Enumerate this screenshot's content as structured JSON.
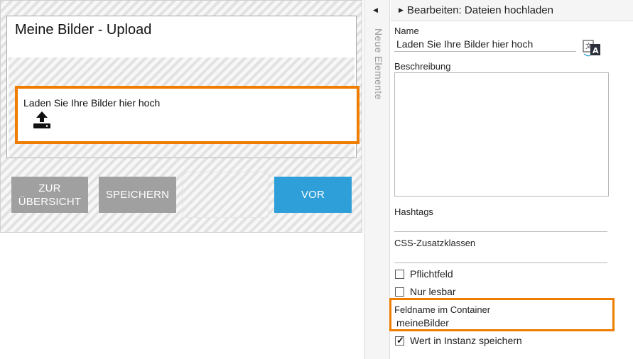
{
  "form": {
    "title": "Meine Bilder - Upload",
    "upload_label": "Laden Sie Ihre Bilder hier hoch",
    "upload_icon": "upload-icon",
    "buttons": {
      "overview_line1": "ZUR",
      "overview_line2": "ÜBERSICHT",
      "save": "SPEICHERN",
      "next": "VOR"
    }
  },
  "side_tab": {
    "label": "Neue Elemente",
    "arrow_icon": "chevron-left-icon"
  },
  "props": {
    "title": "Bearbeiten: Dateien hochladen",
    "arrow_icon": "chevron-right-icon",
    "name_label": "Name",
    "name_value": "Laden Sie Ihre Bilder hier hoch",
    "translate_icon": "translate-icon",
    "description_label": "Beschreibung",
    "description_value": "",
    "hashtags_label": "Hashtags",
    "hashtags_value": "",
    "css_label": "CSS-Zusatzklassen",
    "css_value": "",
    "required_label": "Pflichtfeld",
    "required_checked": false,
    "readonly_label": "Nur lesbar",
    "readonly_checked": false,
    "fieldname_label": "Feldname im Container",
    "fieldname_value": "meineBilder",
    "save_instance_label": "Wert in Instanz speichern",
    "save_instance_checked": true
  },
  "colors": {
    "highlight": "#ef7d00",
    "primary_button": "#2e9fd8",
    "secondary_button": "#a0a0a0"
  }
}
